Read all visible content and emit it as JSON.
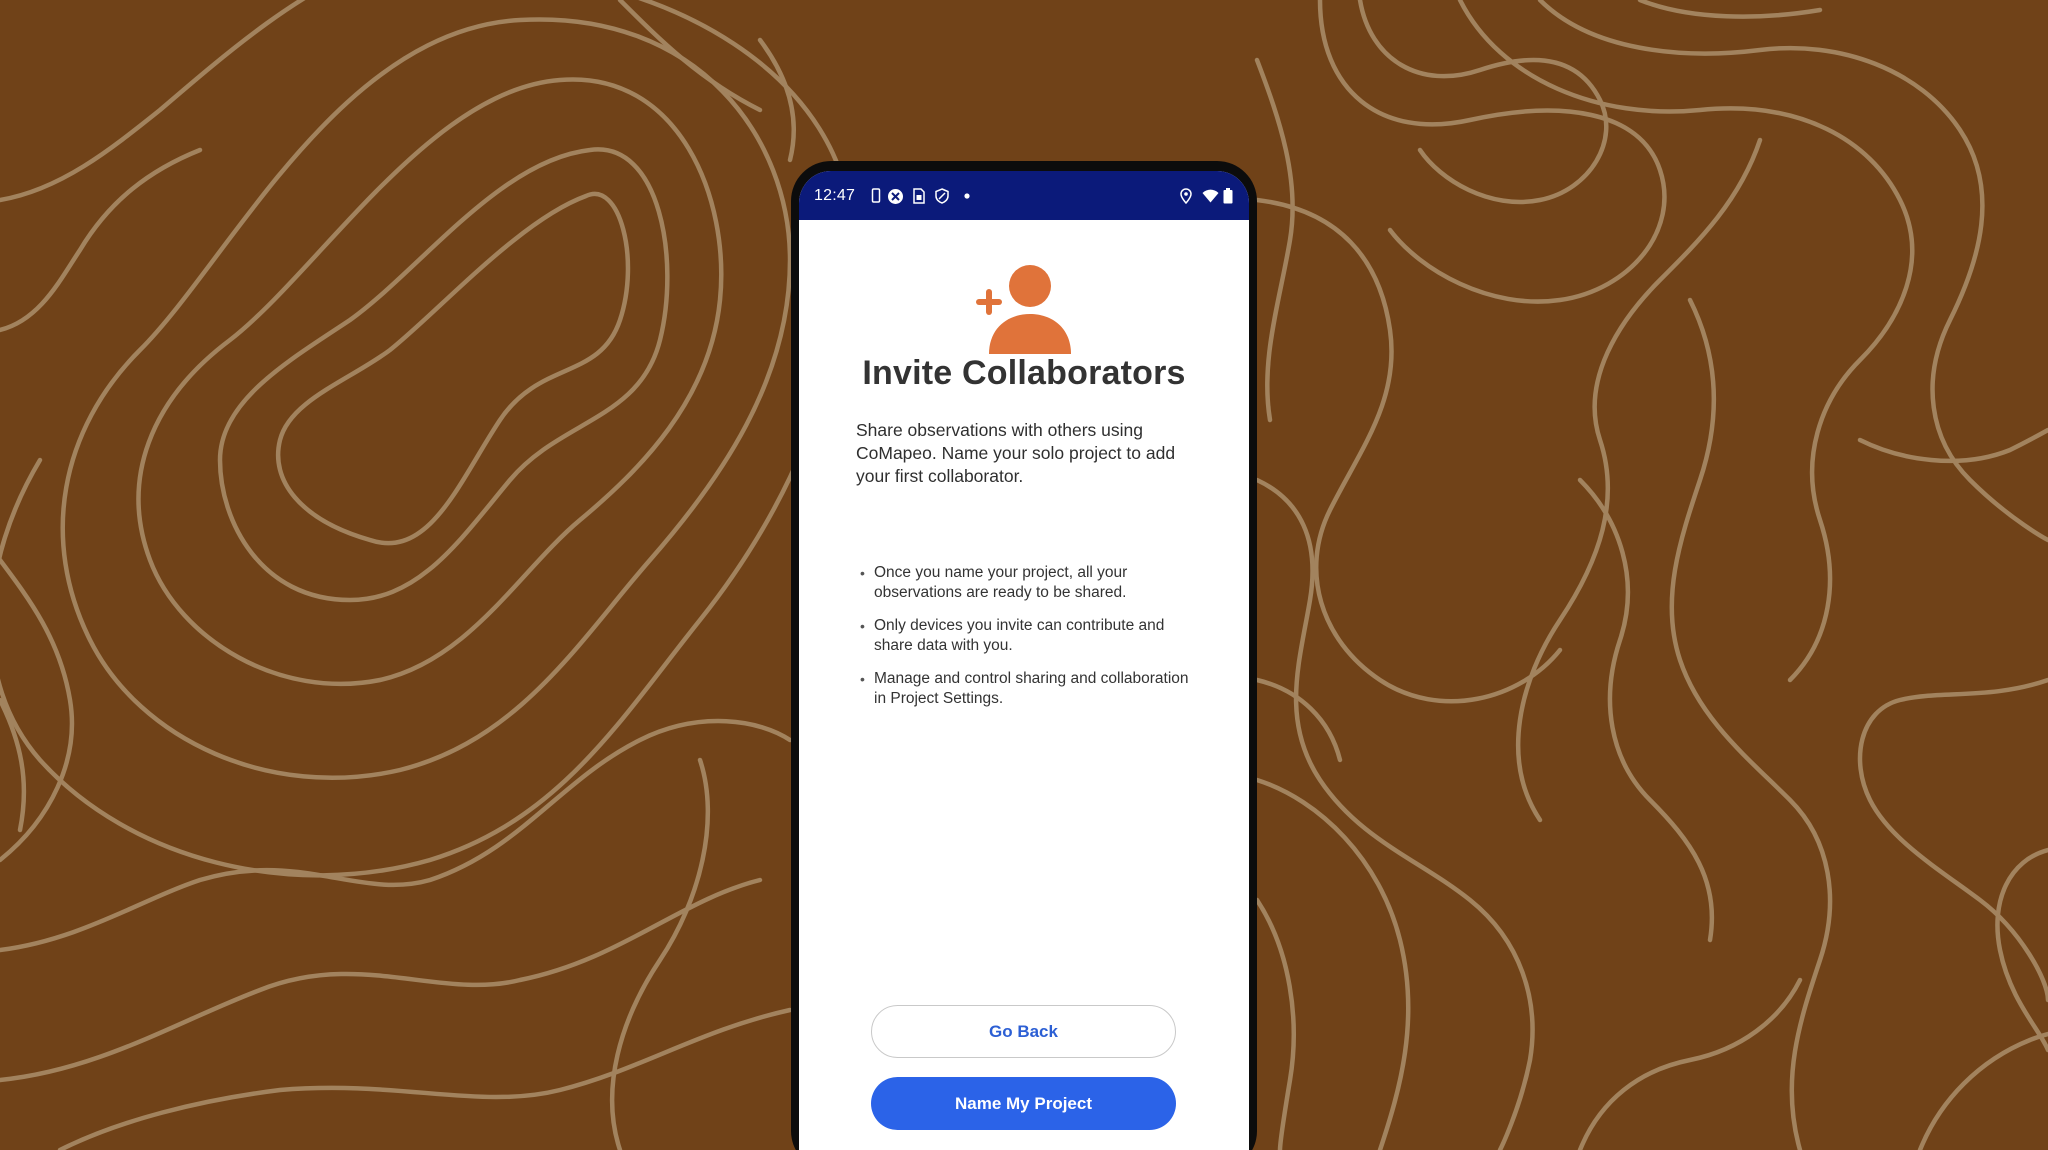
{
  "colors": {
    "background": "#704218",
    "contour_lines": "#a2835e",
    "status_bar": "#0b1a7a",
    "accent_orange": "#e0733a",
    "primary_blue": "#2b63e8",
    "link_blue": "#2c5fd4"
  },
  "status_bar": {
    "time": "12:47",
    "left_icons": [
      "phone-icon",
      "settings-app-icon",
      "sim-icon",
      "shield-icon",
      "dot-icon"
    ],
    "right_icons": [
      "location-icon",
      "wifi-icon",
      "battery-icon"
    ]
  },
  "screen": {
    "hero_icon": "add-person-icon",
    "title": "Invite Collaborators",
    "intro": "Share observations with others using CoMapeo. Name your solo project to add your first collaborator.",
    "bullets": [
      "Once you name your project, all your observations are ready to be shared.",
      "Only devices you invite can contribute and share data with you.",
      "Manage and control sharing and collaboration in Project Settings."
    ],
    "buttons": {
      "back": "Go Back",
      "primary": "Name My Project"
    }
  }
}
